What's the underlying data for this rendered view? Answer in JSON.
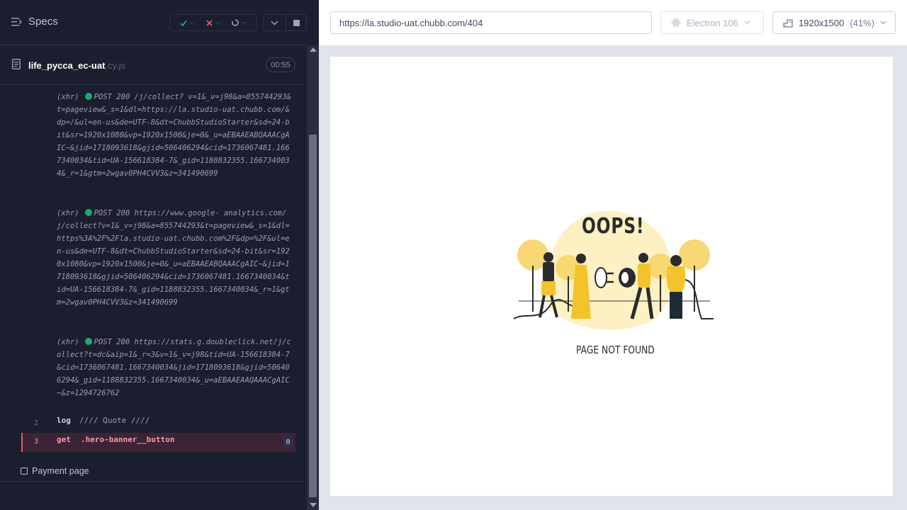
{
  "reporter": {
    "specs_label": "Specs",
    "stats": {
      "passed": "--",
      "failed": "--",
      "pending": "--"
    },
    "spec_name": "life_pycca_ec-uat",
    "spec_ext": ".cy.js",
    "duration": "00:55",
    "log_lines": [
      {
        "type": "xhr",
        "tag": "(xhr)",
        "method": "POST 200 /j/collect?",
        "rest": "v=1&_v=j98&a=855744293&t=pageview&_s=1&dl=https://la.studio-uat.chubb.com/&dp=/&ul=en-us&de=UTF-8&dt=ChubbStudioStarter&sd=24-bit&sr=1920x1080&vp=1920x1500&je=0&_u=aEBAAEABQAAACgAIC~&jid=1718093618&gjid=506406294&cid=1736067481.1667340034&tid=UA-156618384-7&_gid=1188832355.1667340034&_r=1&gtm=2wgav0PH4CVV3&z=341490699"
      },
      {
        "type": "xhr",
        "tag": "(xhr)",
        "method": "POST 200 https://www.google-",
        "rest": "analytics.com/j/collect?v=1&_v=j98&a=855744293&t=pageview&_s=1&dl=https%3A%2F%2Fla.studio-uat.chubb.com%2F&dp=%2F&ul=en-us&de=UTF-8&dt=ChubbStudioStarter&sd=24-bit&sr=1920x1080&vp=1920x1500&je=0&_u=aEBAAEABQAAACgAIC~&jid=1718093618&gjid=506406294&cid=1736067481.1667340034&tid=UA-156618384-7&_gid=1188832355.1667340034&_r=1&gtm=2wgav0PH4CVV3&z=341490699"
      },
      {
        "type": "xhr",
        "tag": "(xhr)",
        "method": "POST 200",
        "rest": "https://stats.g.doubleclick.net/j/collect?t=dc&aip=1&_r=3&v=1&_v=j98&tid=UA-156618384-7&cid=1736067481.1667340034&jid=1718093618&gjid=506406294&_gid=1188832355.1667340034&_u=aEBAAEAAQAAACgAIC~&z=1294726762"
      }
    ],
    "log_command": {
      "num": "2",
      "name": "log",
      "message": "//// Quote ////"
    },
    "error_command": {
      "num": "3",
      "name": "get",
      "selector": ".hero-banner__button",
      "count": "0"
    },
    "suite_label": "Payment page"
  },
  "aut": {
    "url": "https://la.studio-uat.chubb.com/404",
    "browser": "Electron 106",
    "viewport": "1920x1500",
    "scale": "(41%)",
    "oops_text": "OOPS!",
    "not_found_text": "PAGE NOT FOUND"
  },
  "colors": {
    "reporter_bg": "#1b1e2e",
    "passed": "#1fa971",
    "failed": "#e45770",
    "illustration_yellow": "#f4c22b",
    "illustration_light": "#fdf1c4"
  }
}
